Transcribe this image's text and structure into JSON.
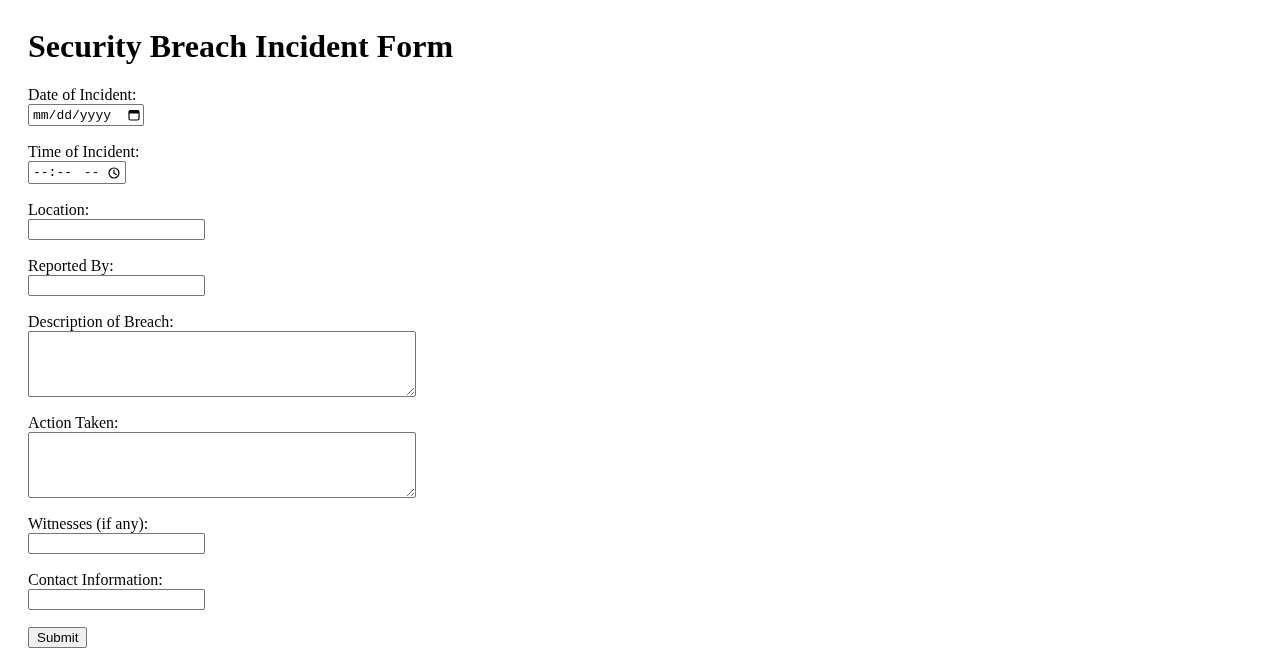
{
  "title": "Security Breach Incident Form",
  "fields": [
    {
      "kind": "date",
      "label": "Date of Incident:",
      "placeholder": "mm/dd/yyyy"
    },
    {
      "kind": "time",
      "label": "Time of Incident:",
      "placeholder": "--:-- --"
    },
    {
      "kind": "text",
      "label": "Location:"
    },
    {
      "kind": "text",
      "label": "Reported By:"
    },
    {
      "kind": "textarea",
      "label": "Description of Breach:"
    },
    {
      "kind": "textarea",
      "label": "Action Taken:"
    },
    {
      "kind": "text",
      "label": "Witnesses (if any):"
    },
    {
      "kind": "text",
      "label": "Contact Information:"
    }
  ],
  "submit": {
    "label": "Submit"
  }
}
